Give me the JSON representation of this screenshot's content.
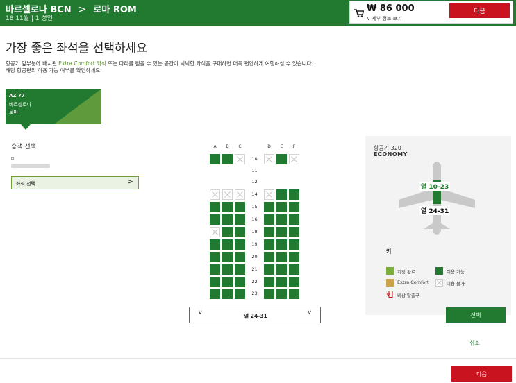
{
  "header": {
    "origin": "바르셀로나 BCN",
    "arrow": ">",
    "destination": "로마 ROM",
    "subtitle": "18 11월 | 1 성인",
    "price": "₩ 86 000",
    "fare_detail": "세부 정보 보기",
    "next_label": "다음"
  },
  "intro": {
    "title": "가장 좋은 좌석을 선택하세요",
    "line1_before": "항공기 앞부분에 배치된 ",
    "line1_highlight": "Extra Comfort 좌석",
    "line1_after": " 또는 다리를 뻗을 수 있는 공간이 넉넉한 좌석을 구매하면 더욱 편안하게 여행하실 수 있습니다.",
    "line2": "해당 항공편의 이용 가능 여부를 확인하세요."
  },
  "flight": {
    "code": "AZ 77",
    "from": "바르셀로나",
    "to": "로마"
  },
  "passenger": {
    "section_title": "승객 선택",
    "select_seat_label": "좌석 선택",
    "chevron": ">"
  },
  "seatmap": {
    "columns": [
      "A",
      "B",
      "C",
      "D",
      "E",
      "F"
    ],
    "rows": [
      {
        "num": "10",
        "seats": [
          "av",
          "av",
          "un",
          "un",
          "av",
          "un"
        ]
      },
      {
        "num": "11",
        "seats": [
          "none",
          "none",
          "none",
          "none",
          "none",
          "none"
        ]
      },
      {
        "num": "12",
        "seats": [
          "none",
          "none",
          "none",
          "none",
          "none",
          "none"
        ]
      },
      {
        "num": "14",
        "seats": [
          "un",
          "un",
          "un",
          "un",
          "av",
          "av"
        ]
      },
      {
        "num": "15",
        "seats": [
          "av",
          "av",
          "av",
          "av",
          "av",
          "av"
        ]
      },
      {
        "num": "16",
        "seats": [
          "av",
          "av",
          "av",
          "av",
          "av",
          "av"
        ]
      },
      {
        "num": "18",
        "seats": [
          "un",
          "av",
          "av",
          "av",
          "av",
          "av"
        ]
      },
      {
        "num": "19",
        "seats": [
          "av",
          "av",
          "av",
          "av",
          "av",
          "av"
        ]
      },
      {
        "num": "20",
        "seats": [
          "av",
          "av",
          "av",
          "av",
          "av",
          "av"
        ]
      },
      {
        "num": "21",
        "seats": [
          "av",
          "av",
          "av",
          "av",
          "av",
          "av"
        ]
      },
      {
        "num": "22",
        "seats": [
          "av",
          "av",
          "av",
          "av",
          "av",
          "av"
        ]
      },
      {
        "num": "23",
        "seats": [
          "av",
          "av",
          "av",
          "av",
          "av",
          "av"
        ]
      }
    ],
    "row_selector": "열 24-31",
    "chevron_left": "∨",
    "chevron_right": "∨"
  },
  "aircraft": {
    "name": "항공기 320",
    "cabin": "ECONOMY",
    "zone1_label": "열",
    "zone1_range": "10-23",
    "zone2_label": "열",
    "zone2_range": "24-31"
  },
  "legend": {
    "title": "키",
    "selected": "지정 완료",
    "available": "이용 가능",
    "extra_comfort": "Extra Comfort",
    "unavailable": "이용 불가",
    "exit": "비상 탈출구"
  },
  "actions": {
    "select": "선택",
    "cancel": "취소",
    "next": "다음"
  },
  "colors": {
    "brand_green": "#217a2f",
    "selected_green": "#7aad3a",
    "extra_comfort": "#c9a44a",
    "next_red": "#c9141f"
  }
}
